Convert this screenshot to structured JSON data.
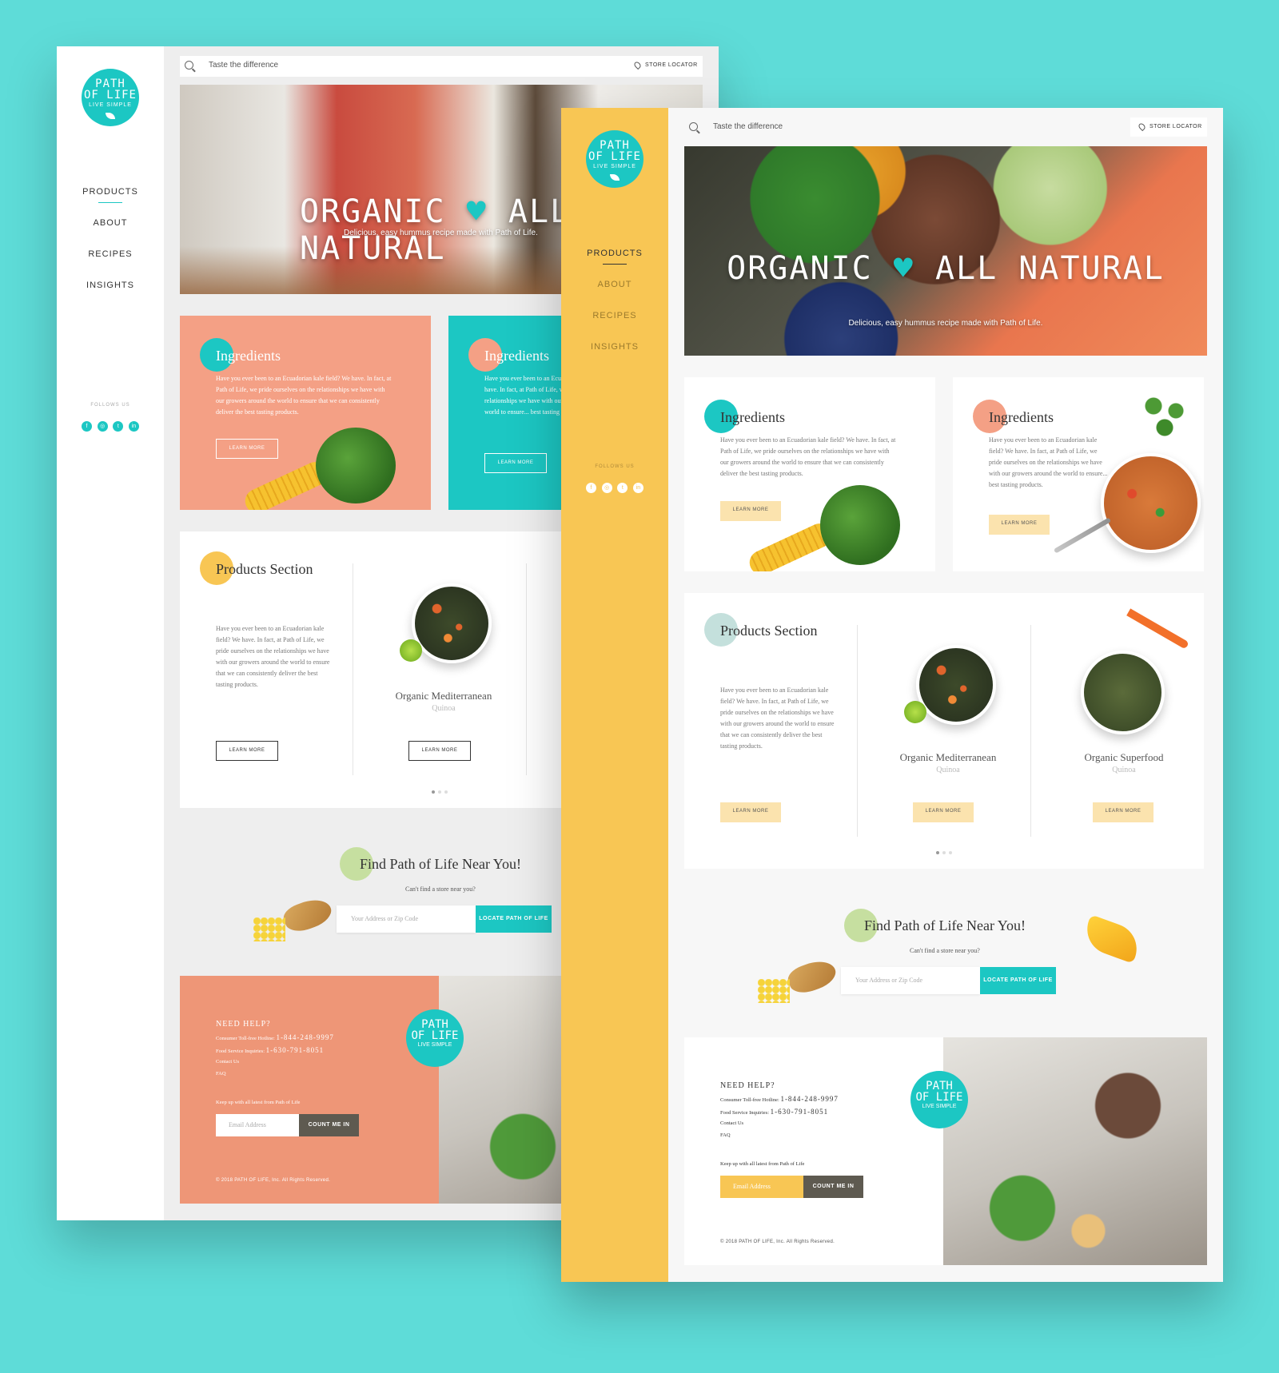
{
  "brand": {
    "logo_line1": "PATH",
    "logo_line2": "OF LIFE",
    "logo_line3": "LIVE SIMPLE"
  },
  "nav": {
    "products": "PRODUCTS",
    "about": "ABOUT",
    "recipes": "RECIPES",
    "insights": "INSIGHTS"
  },
  "follow_label": "FOLLOWS US",
  "socials": [
    "f",
    "◎",
    "t",
    "in"
  ],
  "search": {
    "placeholder": "Taste the difference",
    "store_locator": "STORE LOCATOR"
  },
  "hero": {
    "word1": "ORGANIC",
    "heart": "♥",
    "word2": "ALL NATURAL",
    "subtitle": "Delicious, easy hummus recipe made with Path of Life."
  },
  "ingredients": {
    "title": "Ingredients",
    "text": "Have you ever been to an Ecuadorian kale field? We have. In fact, at Path of Life, we pride ourselves on the relationships we have with our growers around the world to ensure that we can consistently deliver the best tasting products.",
    "text_short": "Have you ever been to an Ecuadorian kale field? We have. In fact, at Path of Life, we pride ourselves on the relationships we have with our growers around the world to ensure... best tasting products.",
    "button": "LEARN MORE"
  },
  "products": {
    "title": "Products Section",
    "text": "Have you ever been to an Ecuadorian kale field? We have. In fact, at Path of Life, we pride ourselves on the relationships we have with our growers around the world to ensure that we can consistently deliver the best tasting products.",
    "button": "LEARN MORE",
    "items": [
      {
        "name": "Organic Mediterranean",
        "sub": "Quinoa"
      },
      {
        "name": "Organic Superfood",
        "sub": "Quinoa"
      }
    ]
  },
  "find": {
    "title": "Find Path of Life Near You!",
    "subtitle": "Can't find a store near you?",
    "placeholder": "Your Address or Zip Code",
    "button": "LOCATE PATH OF LIFE"
  },
  "footer": {
    "help": "NEED HELP?",
    "consumer_label": "Consumer Toll-free Hotline:",
    "consumer_phone": "1-844-248-9997",
    "food_label": "Food Service Inquiries:",
    "food_phone": "1-630-791-8051",
    "contact": "Contact Us",
    "faq": "FAQ",
    "keep_up": "Keep up with all latest from Path of Life",
    "email_placeholder": "Email Address",
    "count_button": "COUNT ME IN",
    "copyright": "© 2018 PATH OF LIFE, Inc. All Rights Reserved."
  },
  "colors": {
    "background": "#5edcd8",
    "teal": "#1cc7c3",
    "yellow": "#f8c654",
    "coral": "#f4a085",
    "salmon": "#ee9677"
  }
}
